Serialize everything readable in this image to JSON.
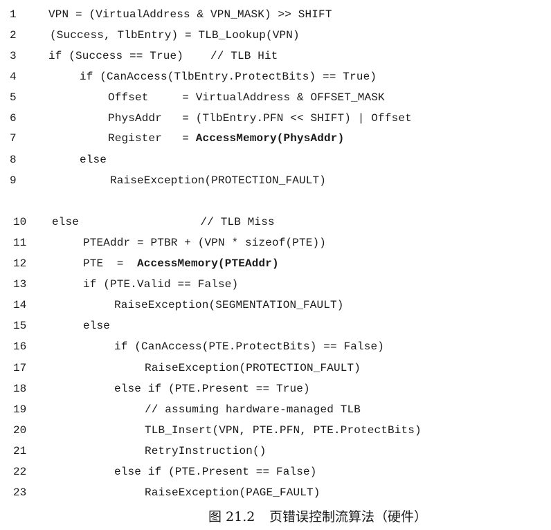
{
  "code_lines": [
    {
      "num": "1",
      "text": "VPN = (VirtualAddress & VPN_MASK) >> SHIFT"
    },
    {
      "num": "2",
      "text": "(Success, TlbEntry) = TLB_Lookup(VPN)"
    },
    {
      "num": "3",
      "text": "if (Success == True)    // TLB Hit"
    },
    {
      "num": "4",
      "text": "if (CanAccess(TlbEntry.ProtectBits) == True)"
    },
    {
      "num": "5",
      "text": "Offset     = VirtualAddress & OFFSET_MASK"
    },
    {
      "num": "6",
      "text": "PhysAddr   = (TlbEntry.PFN << SHIFT) | Offset"
    },
    {
      "num": "7",
      "text": "Register   = ",
      "bold": "AccessMemory(PhysAddr)"
    },
    {
      "num": "8",
      "text": "else"
    },
    {
      "num": "9",
      "text": "RaiseException(PROTECTION_FAULT)"
    },
    {
      "num": "10",
      "text": "else                  // TLB Miss"
    },
    {
      "num": "11",
      "text": "PTEAddr = PTBR + (VPN * sizeof(PTE))"
    },
    {
      "num": "12",
      "text": "PTE  =  ",
      "bold": "AccessMemory(PTEAddr)"
    },
    {
      "num": "13",
      "text": "if (PTE.Valid == False)"
    },
    {
      "num": "14",
      "text": "RaiseException(SEGMENTATION_FAULT)"
    },
    {
      "num": "15",
      "text": "else"
    },
    {
      "num": "16",
      "text": "if (CanAccess(PTE.ProtectBits) == False)"
    },
    {
      "num": "17",
      "text": "RaiseException(PROTECTION_FAULT)"
    },
    {
      "num": "18",
      "text": "else if (PTE.Present == True)"
    },
    {
      "num": "19",
      "text": "// assuming hardware-managed TLB"
    },
    {
      "num": "20",
      "text": "TLB_Insert(VPN, PTE.PFN, PTE.ProtectBits)"
    },
    {
      "num": "21",
      "text": "RetryInstruction()"
    },
    {
      "num": "22",
      "text": "else if (PTE.Present == False)"
    },
    {
      "num": "23",
      "text": "RaiseException(PAGE_FAULT)"
    }
  ],
  "caption": {
    "number": "图 21.2",
    "title": "页错误控制流算法（硬件）"
  }
}
